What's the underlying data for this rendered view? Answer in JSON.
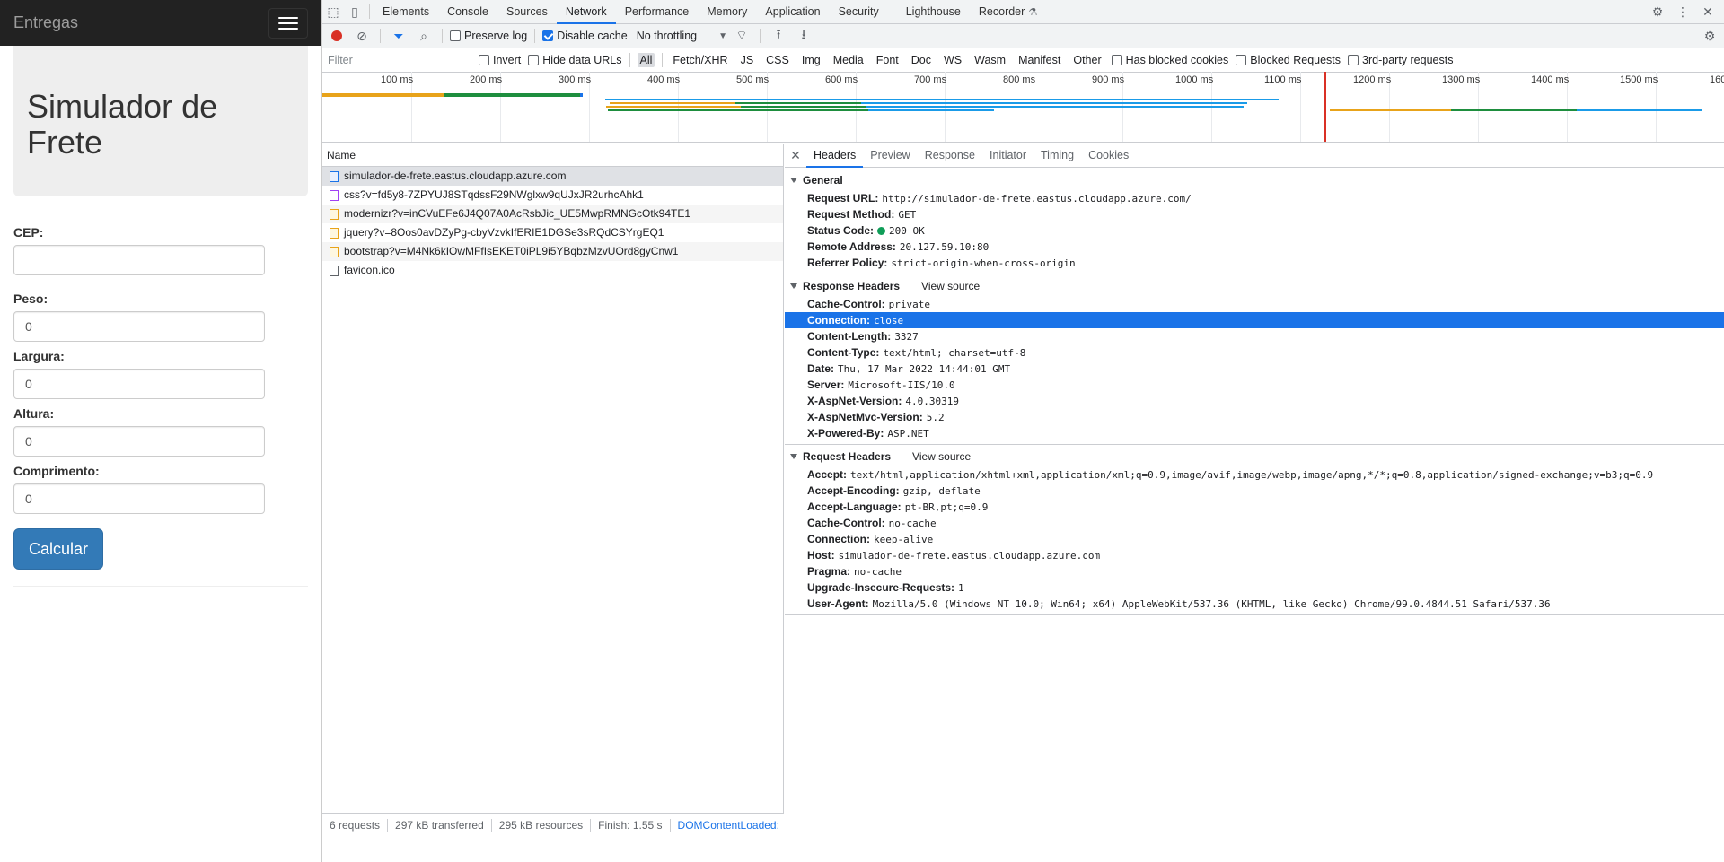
{
  "site": {
    "brand": "Entregas",
    "title": "Simulador de Frete",
    "fields": [
      {
        "label": "CEP:",
        "value": ""
      },
      {
        "label": "Peso:",
        "value": "0"
      },
      {
        "label": "Largura:",
        "value": "0"
      },
      {
        "label": "Altura:",
        "value": "0"
      },
      {
        "label": "Comprimento:",
        "value": "0"
      }
    ],
    "submit_label": "Calcular"
  },
  "devtools": {
    "tabs": [
      "Elements",
      "Console",
      "Sources",
      "Network",
      "Performance",
      "Memory",
      "Application",
      "Security",
      "Lighthouse",
      "Recorder"
    ],
    "active_tab": "Network",
    "toolbar": {
      "preserve_log": "Preserve log",
      "disable_cache": "Disable cache",
      "throttling": "No throttling"
    },
    "filter": {
      "placeholder": "Filter",
      "invert": "Invert",
      "hide_data_urls": "Hide data URLs",
      "types": [
        "All",
        "Fetch/XHR",
        "JS",
        "CSS",
        "Img",
        "Media",
        "Font",
        "Doc",
        "WS",
        "Wasm",
        "Manifest",
        "Other"
      ],
      "has_blocked_cookies": "Has blocked cookies",
      "blocked_requests": "Blocked Requests",
      "third_party": "3rd-party requests"
    },
    "timeline_ticks": [
      "100 ms",
      "200 ms",
      "300 ms",
      "400 ms",
      "500 ms",
      "600 ms",
      "700 ms",
      "800 ms",
      "900 ms",
      "1000 ms",
      "1100 ms",
      "1200 ms",
      "1300 ms",
      "1400 ms",
      "1500 ms",
      "160"
    ],
    "request_list": {
      "header": "Name",
      "requests": [
        {
          "name": "simulador-de-frete.eastus.cloudapp.azure.com",
          "type": "doc"
        },
        {
          "name": "css?v=fd5y8-7ZPYUJ8STqdssF29NWglxw9qUJxJR2urhcAhk1",
          "type": "css"
        },
        {
          "name": "modernizr?v=inCVuEFe6J4Q07A0AcRsbJic_UE5MwpRMNGcOtk94TE1",
          "type": "js"
        },
        {
          "name": "jquery?v=8Oos0avDZyPg-cbyVzvkIfERIE1DGSe3sRQdCSYrgEQ1",
          "type": "js"
        },
        {
          "name": "bootstrap?v=M4Nk6kIOwMFfIsEKET0iPL9i5YBqbzMzvUOrd8gyCnw1",
          "type": "js"
        },
        {
          "name": "favicon.ico",
          "type": "ico"
        }
      ],
      "status": {
        "requests": "6 requests",
        "transferred": "297 kB transferred",
        "resources": "295 kB resources",
        "finish": "Finish: 1.55 s",
        "dcl": "DOMContentLoaded:"
      }
    },
    "details": {
      "tabs": [
        "Headers",
        "Preview",
        "Response",
        "Initiator",
        "Timing",
        "Cookies"
      ],
      "active": "Headers",
      "general_title": "General",
      "general": [
        {
          "k": "Request URL:",
          "v": "http://simulador-de-frete.eastus.cloudapp.azure.com/"
        },
        {
          "k": "Request Method:",
          "v": "GET"
        },
        {
          "k": "Status Code:",
          "v": "200 OK"
        },
        {
          "k": "Remote Address:",
          "v": "20.127.59.10:80"
        },
        {
          "k": "Referrer Policy:",
          "v": "strict-origin-when-cross-origin"
        }
      ],
      "response_title": "Response Headers",
      "view_source": "View source",
      "response": [
        {
          "k": "Cache-Control:",
          "v": "private"
        },
        {
          "k": "Connection:",
          "v": "close"
        },
        {
          "k": "Content-Length:",
          "v": "3327"
        },
        {
          "k": "Content-Type:",
          "v": "text/html; charset=utf-8"
        },
        {
          "k": "Date:",
          "v": "Thu, 17 Mar 2022 14:44:01 GMT"
        },
        {
          "k": "Server:",
          "v": "Microsoft-IIS/10.0"
        },
        {
          "k": "X-AspNet-Version:",
          "v": "4.0.30319"
        },
        {
          "k": "X-AspNetMvc-Version:",
          "v": "5.2"
        },
        {
          "k": "X-Powered-By:",
          "v": "ASP.NET"
        }
      ],
      "request_title": "Request Headers",
      "request": [
        {
          "k": "Accept:",
          "v": "text/html,application/xhtml+xml,application/xml;q=0.9,image/avif,image/webp,image/apng,*/*;q=0.8,application/signed-exchange;v=b3;q=0.9"
        },
        {
          "k": "Accept-Encoding:",
          "v": "gzip, deflate"
        },
        {
          "k": "Accept-Language:",
          "v": "pt-BR,pt;q=0.9"
        },
        {
          "k": "Cache-Control:",
          "v": "no-cache"
        },
        {
          "k": "Connection:",
          "v": "keep-alive"
        },
        {
          "k": "Host:",
          "v": "simulador-de-frete.eastus.cloudapp.azure.com"
        },
        {
          "k": "Pragma:",
          "v": "no-cache"
        },
        {
          "k": "Upgrade-Insecure-Requests:",
          "v": "1"
        },
        {
          "k": "User-Agent:",
          "v": "Mozilla/5.0 (Windows NT 10.0; Win64; x64) AppleWebKit/537.36 (KHTML, like Gecko) Chrome/99.0.4844.51 Safari/537.36"
        }
      ]
    }
  }
}
